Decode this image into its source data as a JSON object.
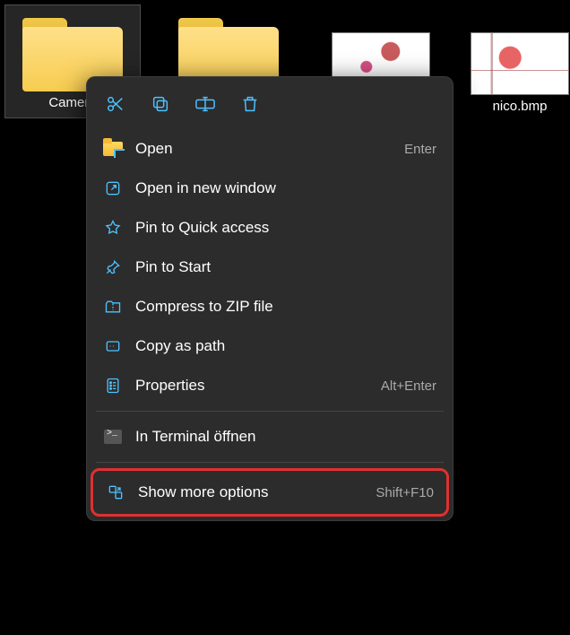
{
  "desktop": {
    "items": [
      {
        "label": "Camera",
        "type": "folder",
        "selected": true
      },
      {
        "label": "",
        "type": "folder",
        "selected": false
      },
      {
        "label": "",
        "type": "image",
        "selected": false
      },
      {
        "label": "nico.bmp",
        "type": "image",
        "selected": false
      }
    ]
  },
  "context_menu": {
    "quick_actions": [
      "cut",
      "copy",
      "rename",
      "delete"
    ],
    "items": [
      {
        "icon": "folder-open",
        "label": "Open",
        "shortcut": "Enter"
      },
      {
        "icon": "external",
        "label": "Open in new window",
        "shortcut": ""
      },
      {
        "icon": "star",
        "label": "Pin to Quick access",
        "shortcut": ""
      },
      {
        "icon": "pin",
        "label": "Pin to Start",
        "shortcut": ""
      },
      {
        "icon": "zip",
        "label": "Compress to ZIP file",
        "shortcut": ""
      },
      {
        "icon": "copypath",
        "label": "Copy as path",
        "shortcut": ""
      },
      {
        "icon": "properties",
        "label": "Properties",
        "shortcut": "Alt+Enter"
      }
    ],
    "terminal": {
      "label": "In  Terminal öffnen"
    },
    "more": {
      "label": "Show more options",
      "shortcut": "Shift+F10"
    }
  }
}
